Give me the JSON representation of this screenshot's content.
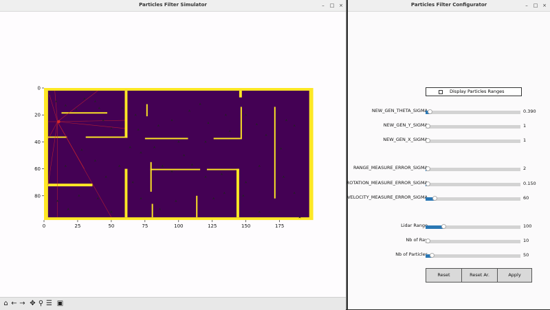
{
  "simulator": {
    "title": "Particles Filter Simulator",
    "controls": {
      "minimize": "–",
      "maximize": "□",
      "close": "×"
    },
    "plot": {
      "xticks": [
        "0",
        "25",
        "50",
        "75",
        "100",
        "125",
        "150",
        "175"
      ],
      "yticks": [
        "0",
        "20",
        "40",
        "60",
        "80"
      ],
      "colors": {
        "floor": "#440154",
        "wall": "#fde725",
        "lidar": "#d62728",
        "particle": "#222222"
      }
    },
    "toolbar": [
      {
        "name": "home-icon",
        "glyph": "⌂"
      },
      {
        "name": "back-arrow-icon",
        "glyph": "←"
      },
      {
        "name": "forward-arrow-icon",
        "glyph": "→"
      },
      {
        "name": "pan-icon",
        "glyph": "✥"
      },
      {
        "name": "zoom-icon",
        "glyph": "⚲"
      },
      {
        "name": "configure-subplots-icon",
        "glyph": "☰"
      },
      {
        "name": "save-icon",
        "glyph": "▣"
      }
    ]
  },
  "configurator": {
    "title": "Particles Filter Configurator",
    "controls": {
      "minimize": "–",
      "maximize": "□",
      "close": "×"
    },
    "checkbox_label": "Display Particles Ranges",
    "accent": "#2a77b4",
    "sliders": [
      {
        "label": "NEW_GEN_THETA_SIGMA",
        "value": "0.390",
        "level": 0.05
      },
      {
        "label": "NEW_GEN_Y_SIGMA",
        "value": "1",
        "level": 0.0
      },
      {
        "label": "NEW_GEN_X_SIGMA",
        "value": "1",
        "level": 0.0
      },
      {
        "label": "RANGE_MEASURE_ERROR_SIGMA",
        "value": "2",
        "level": 0.005
      },
      {
        "label": "ROTATION_MEASURE_ERROR_SIGMA",
        "value": "0.150",
        "level": 0.005
      },
      {
        "label": "VELOCITY_MEASURE_ERROR_SIGMA",
        "value": "60",
        "level": 0.1
      },
      {
        "label": "Lidar Range",
        "value": "100",
        "level": 0.19
      },
      {
        "label": "Nb of Ray",
        "value": "10",
        "level": 0.0
      },
      {
        "label": "Nb of Particles",
        "value": "50",
        "level": 0.07
      }
    ],
    "buttons": {
      "reset": "Reset",
      "reset_ar": "Reset Ar.",
      "apply": "Apply"
    }
  }
}
